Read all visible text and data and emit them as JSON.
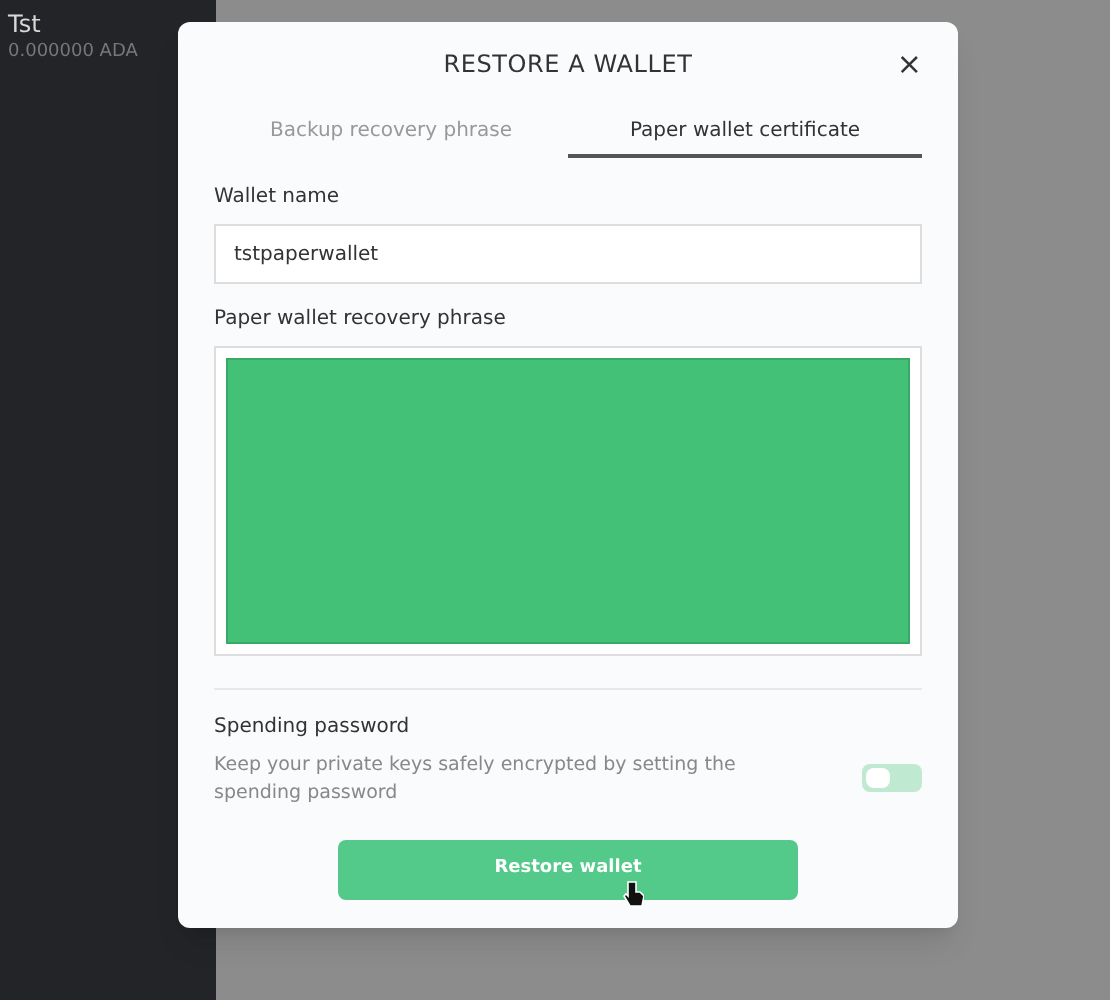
{
  "sidebar": {
    "wallet_name": "Tst",
    "balance": "0.000000 ADA"
  },
  "dialog": {
    "title": "RESTORE A WALLET",
    "close": "×",
    "tabs": [
      {
        "label": "Backup recovery phrase",
        "selected": false
      },
      {
        "label": "Paper wallet certificate",
        "selected": true
      }
    ],
    "wallet_name": {
      "label": "Wallet name",
      "value": "tstpaperwallet"
    },
    "recovery_phrase": {
      "label": "Paper wallet recovery phrase"
    },
    "spending_password": {
      "label": "Spending password",
      "description": "Keep your private keys safely encrypted by setting the spending password",
      "on": false
    },
    "submit": "Restore wallet"
  }
}
